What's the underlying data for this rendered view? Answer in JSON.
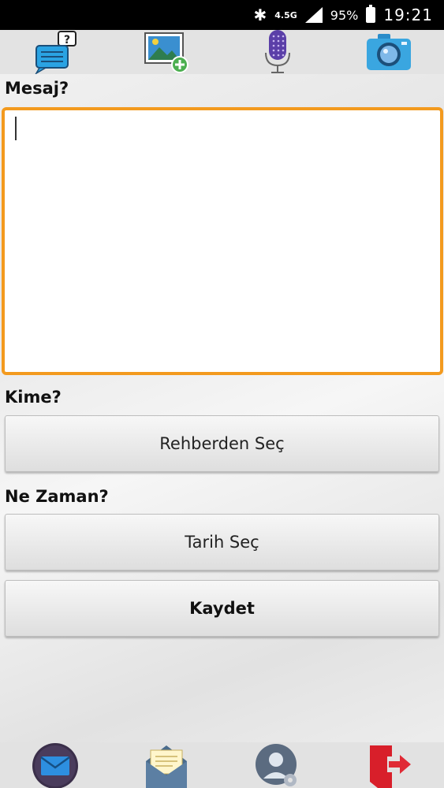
{
  "status_bar": {
    "network": "4.5G",
    "battery": "95%",
    "time": "19:21"
  },
  "toolbar": {
    "icons": [
      "message-help-icon",
      "add-image-icon",
      "microphone-icon",
      "camera-icon"
    ]
  },
  "form": {
    "message_label": "Mesaj?",
    "message_value": "",
    "recipient_label": "Kime?",
    "recipient_button": "Rehberden Seç",
    "when_label": "Ne Zaman?",
    "date_button": "Tarih Seç",
    "save_button": "Kaydet"
  },
  "bottom_nav": {
    "icons": [
      "mail-icon",
      "open-envelope-icon",
      "contact-settings-icon",
      "exit-icon"
    ]
  },
  "colors": {
    "accent_border": "#f39a1e",
    "status_bar": "#000000"
  }
}
